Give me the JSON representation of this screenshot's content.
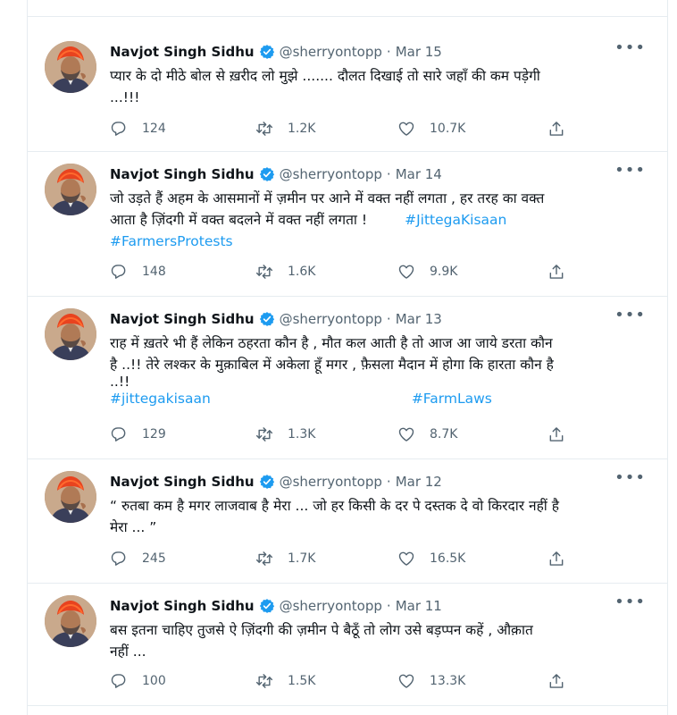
{
  "author": {
    "name": "Navjot Singh Sidhu",
    "handle": "@sherryontopp"
  },
  "colors": {
    "hashtag": "#1d9bf0",
    "verified": "#1d9bf0",
    "muted": "#536471",
    "divider": "#e6ecf0"
  },
  "tweets": [
    {
      "date": "Mar 15",
      "lines": [
        "प्यार के दो मीठे  बोल से  ख़रीद लो  मुझे ....... दौलत दिखाई तो सारे जहाँ की कम पड़ेगी",
        "...!!!"
      ],
      "hashtags": [],
      "replies": "124",
      "retweets": "1.2K",
      "likes": "10.7K"
    },
    {
      "date": "Mar 14",
      "lines": [
        "जो उड़ते हैं अहम के आसमानों में ज़मीन पर आने में वक्त नहीं लगता , हर तरह का वक्त",
        "आता है ज़िंदगी में वक्त बदलने में वक्त नहीं लगता !"
      ],
      "hashtags": [
        "#JittegaKisaan",
        "#FarmersProtests"
      ],
      "replies": "148",
      "retweets": "1.6K",
      "likes": "9.9K"
    },
    {
      "date": "Mar 13",
      "lines": [
        "राह में ख़तरे भी हैं लेकिन ठहरता कौन है , मौत कल आती है तो आज आ जाये डरता कौन",
        "है ..!!  तेरे लश्कर के मुक़ाबिल में अकेला हूँ मगर , फ़ैसला मैदान में होगा कि हारता कौन है",
        "..!!"
      ],
      "hashtags": [
        "#jittegakisaan",
        "#FarmLaws"
      ],
      "replies": "129",
      "retweets": "1.3K",
      "likes": "8.7K"
    },
    {
      "date": "Mar 12",
      "lines": [
        "“ रुतबा कम है मगर लाजवाब है मेरा ... जो हर किसी के दर पे दस्तक दे वो किरदार नहीं है",
        "मेरा ... ”"
      ],
      "hashtags": [],
      "replies": "245",
      "retweets": "1.7K",
      "likes": "16.5K"
    },
    {
      "date": "Mar 11",
      "lines": [
        "बस इतना चाहिए तुजसे ऐ ज़िंदगी की ज़मीन पे बैठूँ तो लोग उसे बड़प्पन कहें , औक़ात",
        "नहीं ..."
      ],
      "hashtags": [],
      "replies": "100",
      "retweets": "1.5K",
      "likes": "13.3K"
    }
  ]
}
